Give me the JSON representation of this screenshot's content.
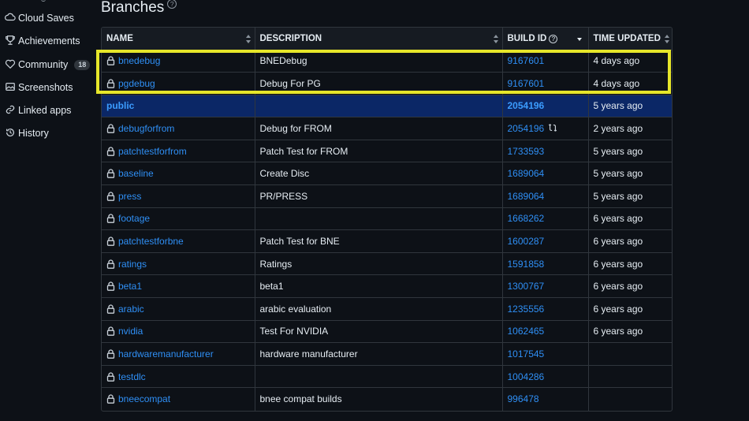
{
  "sidebar": {
    "items": [
      {
        "label": "Cloud Saves",
        "icon": "cloud-icon"
      },
      {
        "label": "Achievements",
        "icon": "trophy-icon"
      },
      {
        "label": "Community",
        "icon": "heart-icon",
        "badge": "18"
      },
      {
        "label": "Screenshots",
        "icon": "image-icon"
      },
      {
        "label": "Linked apps",
        "icon": "link-icon"
      },
      {
        "label": "History",
        "icon": "history-icon"
      }
    ]
  },
  "page": {
    "title": "Branches",
    "title_help": "?"
  },
  "table": {
    "headers": {
      "name": "NAME",
      "description": "DESCRIPTION",
      "build_id": "BUILD ID",
      "build_help": "?",
      "time_updated": "TIME UPDATED"
    },
    "rows": [
      {
        "name": "bnedebug",
        "description": "BNEDebug",
        "build_id": "9167601",
        "time": "4 days ago",
        "locked": true
      },
      {
        "name": "pgdebug",
        "description": "Debug For PG",
        "build_id": "9167601",
        "time": "4 days ago",
        "locked": true
      },
      {
        "name": "public",
        "description": "",
        "build_id": "2054196",
        "time": "5 years ago",
        "locked": false
      },
      {
        "name": "debugforfrom",
        "description": "Debug for FROM",
        "build_id": "2054196",
        "time": "2 years ago",
        "locked": true,
        "refresh": true
      },
      {
        "name": "patchtestforfrom",
        "description": "Patch Test for FROM",
        "build_id": "1733593",
        "time": "5 years ago",
        "locked": true
      },
      {
        "name": "baseline",
        "description": "Create Disc",
        "build_id": "1689064",
        "time": "5 years ago",
        "locked": true
      },
      {
        "name": "press",
        "description": "PR/PRESS",
        "build_id": "1689064",
        "time": "5 years ago",
        "locked": true
      },
      {
        "name": "footage",
        "description": "",
        "build_id": "1668262",
        "time": "6 years ago",
        "locked": true
      },
      {
        "name": "patchtestforbne",
        "description": "Patch Test for BNE",
        "build_id": "1600287",
        "time": "6 years ago",
        "locked": true
      },
      {
        "name": "ratings",
        "description": "Ratings",
        "build_id": "1591858",
        "time": "6 years ago",
        "locked": true
      },
      {
        "name": "beta1",
        "description": "beta1",
        "build_id": "1300767",
        "time": "6 years ago",
        "locked": true
      },
      {
        "name": "arabic",
        "description": "arabic evaluation",
        "build_id": "1235556",
        "time": "6 years ago",
        "locked": true
      },
      {
        "name": "nvidia",
        "description": "Test For NVIDIA",
        "build_id": "1062465",
        "time": "6 years ago",
        "locked": true
      },
      {
        "name": "hardwaremanufacturer",
        "description": "hardware manufacturer",
        "build_id": "1017545",
        "time": "",
        "locked": true
      },
      {
        "name": "testdlc",
        "description": "",
        "build_id": "1004286",
        "time": "",
        "locked": true
      },
      {
        "name": "bneecompat",
        "description": "bnee compat builds",
        "build_id": "996478",
        "time": "",
        "locked": true
      }
    ]
  },
  "colors": {
    "highlight": "#e6e62a",
    "link": "#2f8ff5",
    "public_row": "#0b2766",
    "background": "#0d1117"
  }
}
